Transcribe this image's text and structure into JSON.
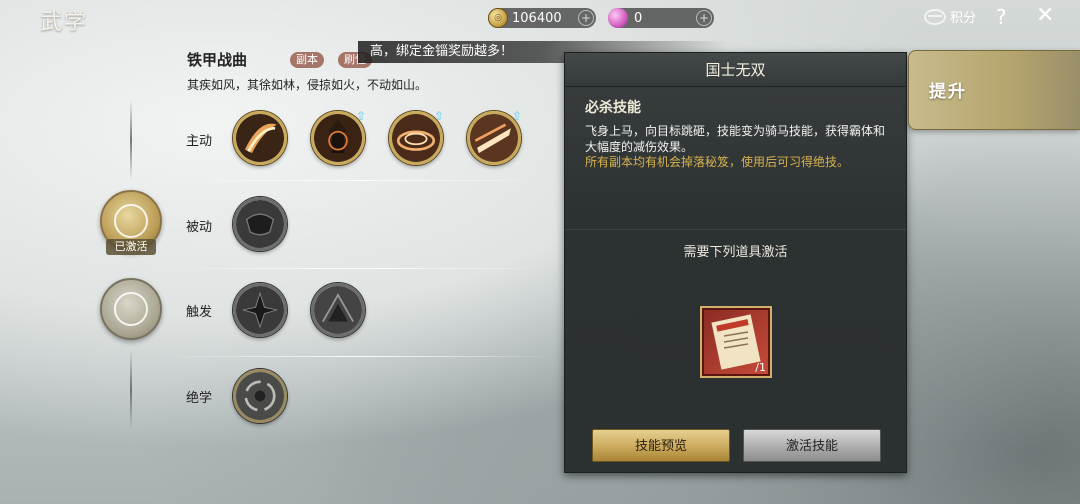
{
  "header": {
    "title": "武学",
    "gold": "106400",
    "gems": "0",
    "score_label": "积分",
    "help_symbol": "?",
    "close_symbol": "✕"
  },
  "marquee": {
    "text": "高，绑定金锱奖励越多！"
  },
  "set": {
    "name": "铁甲战曲",
    "tags": [
      "副本",
      "刷怪"
    ],
    "motto": "其疾如风，其徐如林，侵掠如火，不动如山。"
  },
  "rows": {
    "active": "主动",
    "passive": "被动",
    "trigger": "触发",
    "ultimate": "绝学"
  },
  "badge_status": "已激活",
  "panel": {
    "title": "国士无双",
    "subtitle": "必杀技能",
    "description": "飞身上马，向目标跳砸，技能变为骑马技能，获得霸体和大幅度的减伤效果。",
    "hint": "所有副本均有机会掉落秘笈，使用后可习得绝技。",
    "need_text": "需要下列道具激活",
    "item_count": "/1",
    "preview_button": "技能预览",
    "activate_button": "激活技能"
  },
  "side_tab": {
    "label": "提升"
  },
  "colors": {
    "gold_accent": "#c9a95a",
    "hint_gold": "#d8b24e",
    "upgrade_arrow": "#7fd8f0"
  }
}
